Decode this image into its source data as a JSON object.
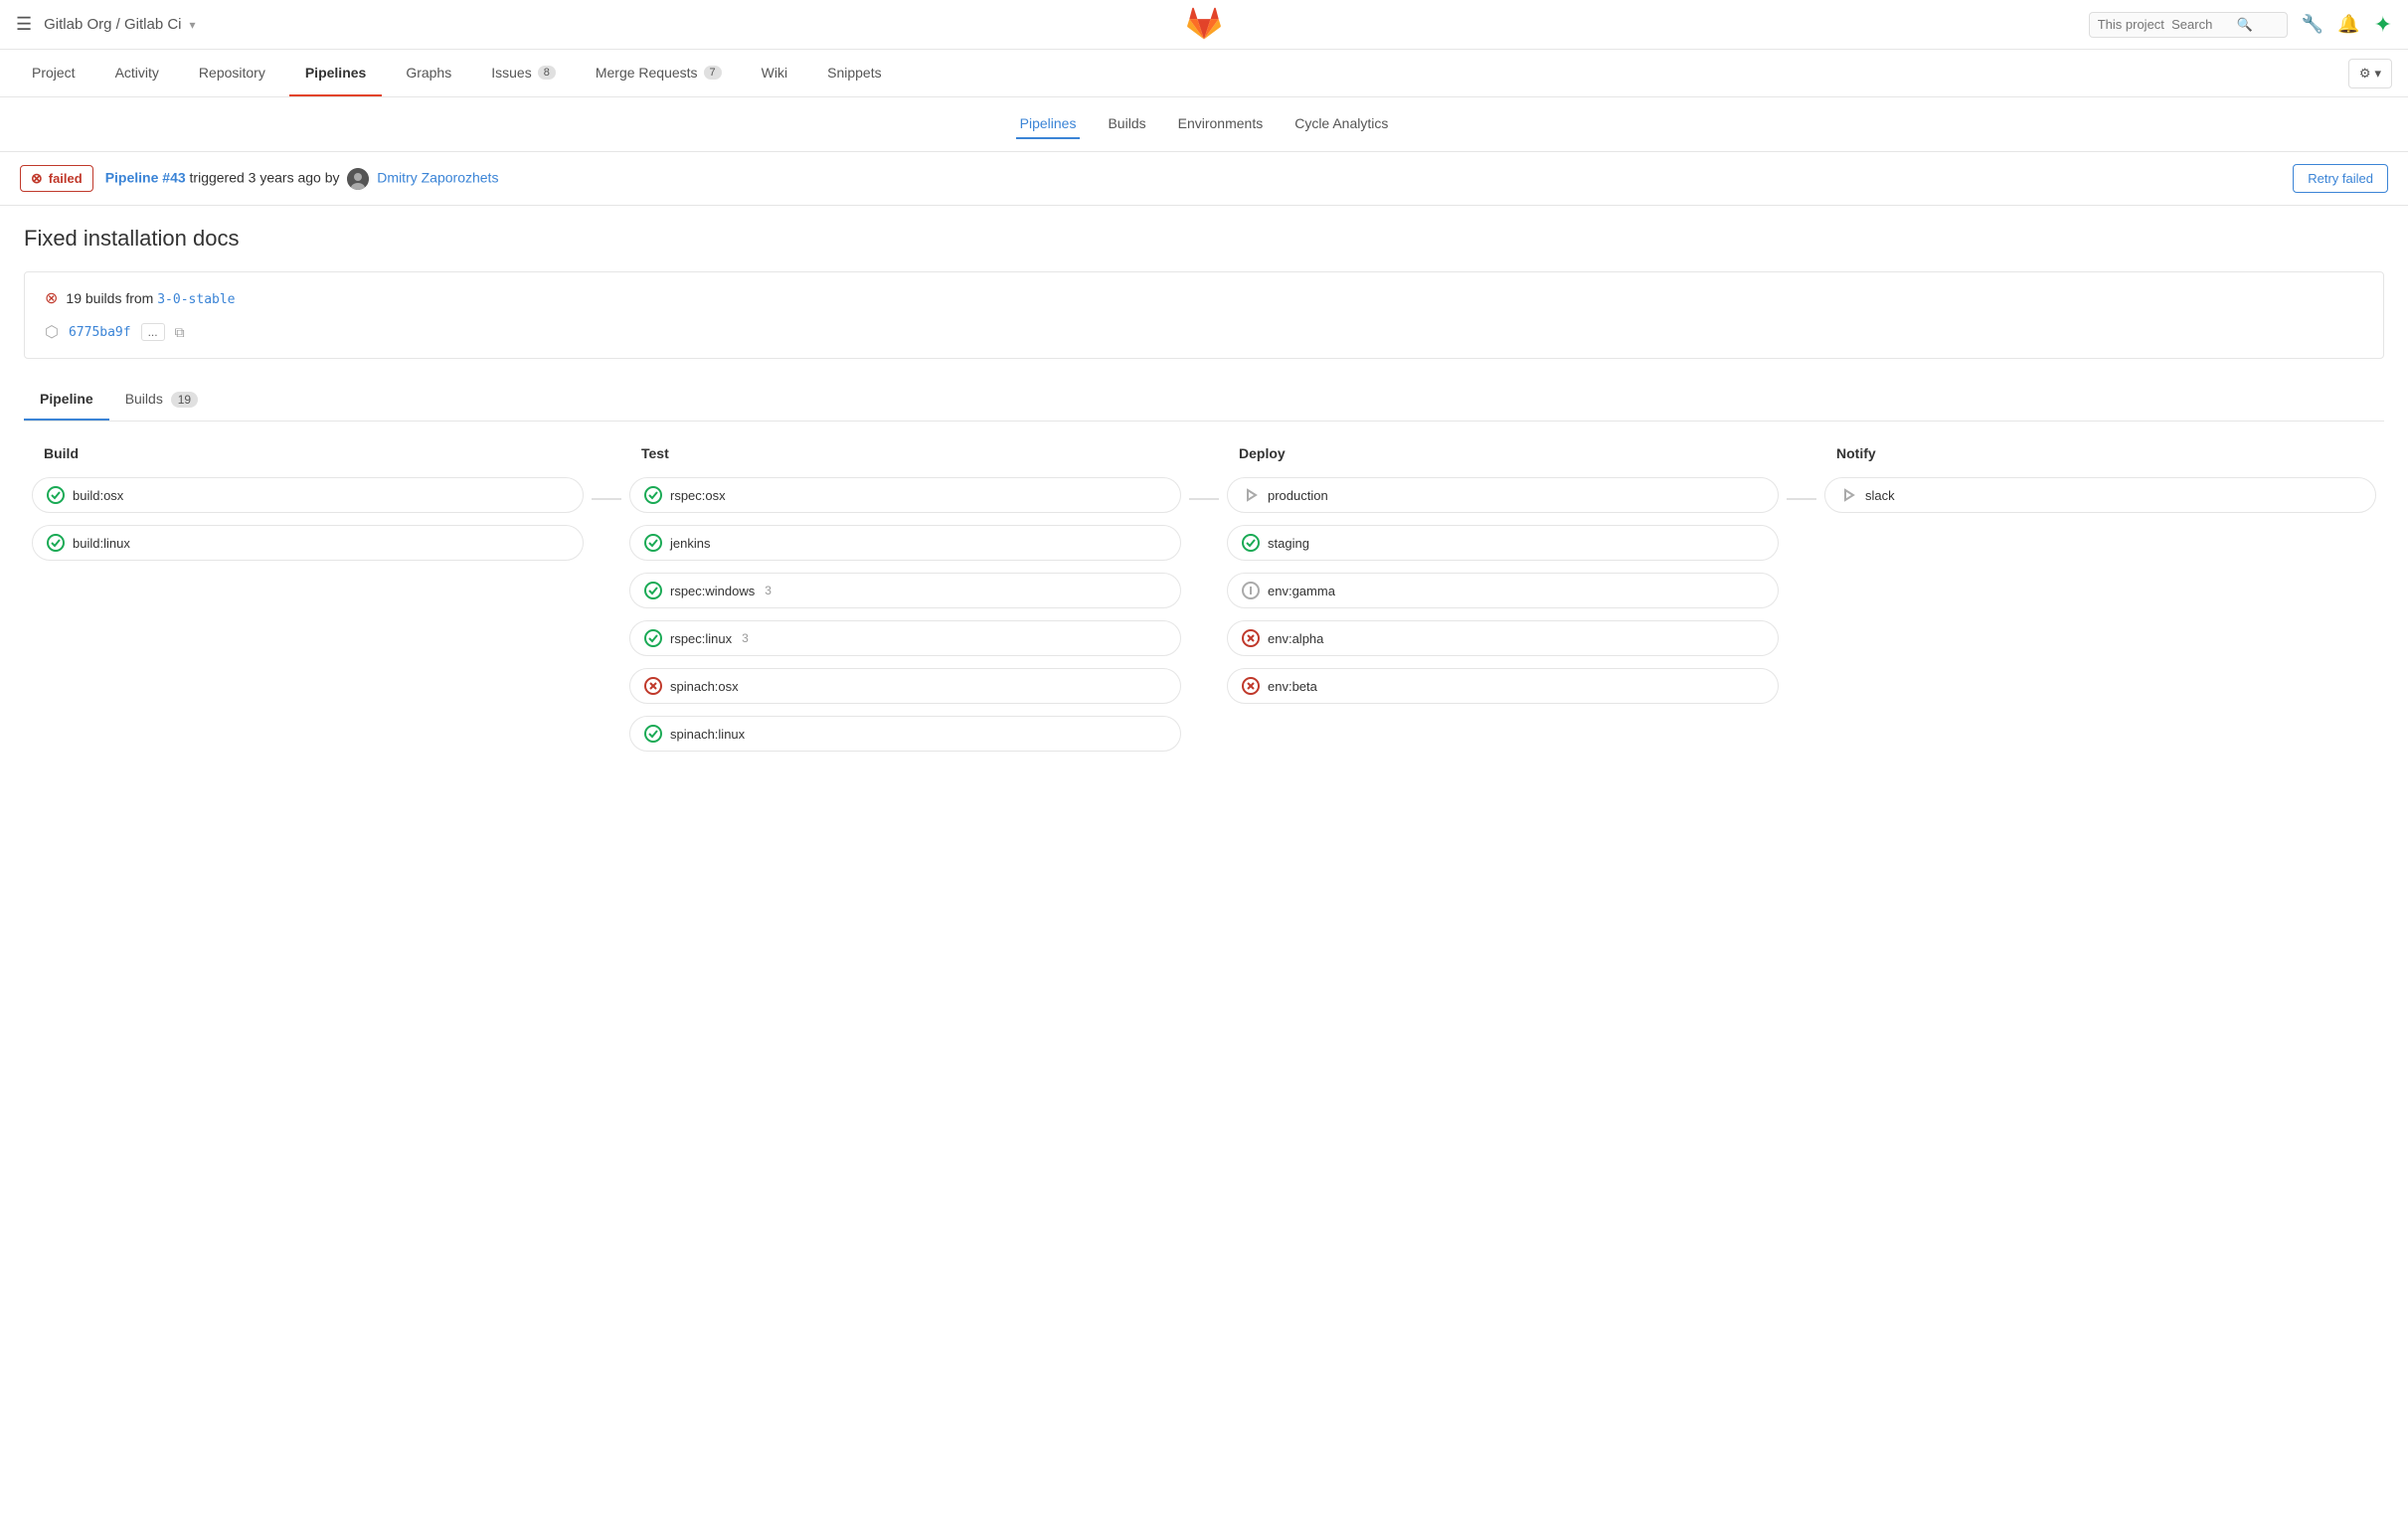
{
  "topNav": {
    "hamburger": "☰",
    "breadcrumb": "Gitlab Org / Gitlab Ci",
    "breadcrumbCaret": "▾",
    "searchPlaceholder": "This project  Search",
    "settingsLabel": "⚙"
  },
  "mainNav": {
    "items": [
      {
        "label": "Project",
        "active": false
      },
      {
        "label": "Activity",
        "active": false
      },
      {
        "label": "Repository",
        "active": false
      },
      {
        "label": "Pipelines",
        "active": true
      },
      {
        "label": "Graphs",
        "active": false
      },
      {
        "label": "Issues",
        "badge": "8",
        "active": false
      },
      {
        "label": "Merge Requests",
        "badge": "7",
        "active": false
      },
      {
        "label": "Wiki",
        "active": false
      },
      {
        "label": "Snippets",
        "active": false
      }
    ]
  },
  "subNav": {
    "items": [
      {
        "label": "Pipelines",
        "active": true
      },
      {
        "label": "Builds",
        "active": false
      },
      {
        "label": "Environments",
        "active": false
      },
      {
        "label": "Cycle Analytics",
        "active": false
      }
    ]
  },
  "pipelineStatus": {
    "statusLabel": "failed",
    "pipelineNumber": "#43",
    "triggeredText": "triggered 3 years ago by",
    "username": "Dmitry Zaporozhets",
    "retryLabel": "Retry failed"
  },
  "pageTitle": "Fixed installation docs",
  "pipelineCard": {
    "buildsCount": "19",
    "buildsText": "19 builds from",
    "branchName": "3-0-stable",
    "commitHash": "6775ba9f",
    "ellipsis": "..."
  },
  "tabs": {
    "pipeline": "Pipeline",
    "builds": "Builds",
    "buildsCount": "19"
  },
  "stages": [
    {
      "name": "Build",
      "jobs": [
        {
          "label": "build:osx",
          "status": "success"
        },
        {
          "label": "build:linux",
          "status": "success"
        }
      ]
    },
    {
      "name": "Test",
      "jobs": [
        {
          "label": "rspec:osx",
          "status": "success"
        },
        {
          "label": "jenkins",
          "status": "success"
        },
        {
          "label": "rspec:windows",
          "status": "success",
          "count": "3"
        },
        {
          "label": "rspec:linux",
          "status": "success",
          "count": "3"
        },
        {
          "label": "spinach:osx",
          "status": "failed"
        },
        {
          "label": "spinach:linux",
          "status": "success"
        }
      ]
    },
    {
      "name": "Deploy",
      "jobs": [
        {
          "label": "production",
          "status": "pending"
        },
        {
          "label": "staging",
          "status": "success"
        },
        {
          "label": "env:gamma",
          "status": "skipped"
        },
        {
          "label": "env:alpha",
          "status": "failed"
        },
        {
          "label": "env:beta",
          "status": "failed"
        }
      ]
    },
    {
      "name": "Notify",
      "jobs": [
        {
          "label": "slack",
          "status": "pending"
        }
      ]
    }
  ]
}
